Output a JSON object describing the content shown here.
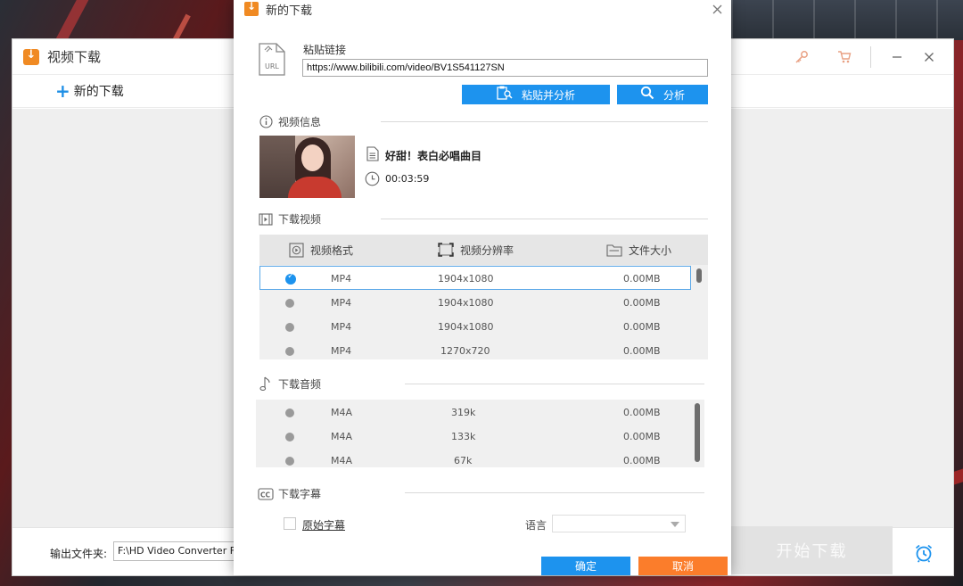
{
  "main": {
    "title": "视频下载",
    "new_download": "新的下载",
    "output_label": "输出文件夹:",
    "output_path": "F:\\HD Video Converter Factory",
    "start_button": "开始下载"
  },
  "dialog": {
    "title": "新的下载",
    "paste_label": "粘贴链接",
    "url_value": "https://www.bilibili.com/video/BV1S541127SN",
    "paste_analyze_button": "粘贴并分析",
    "analyze_button": "分析",
    "sections": {
      "video_info": "视频信息",
      "download_video": "下载视频",
      "download_audio": "下载音频",
      "download_subtitle": "下载字幕"
    },
    "video": {
      "title": "好甜！表白必唱曲目",
      "duration": "00:03:59"
    },
    "video_table": {
      "headers": [
        "视频格式",
        "视频分辨率",
        "文件大小"
      ],
      "rows": [
        {
          "format": "MP4",
          "resolution": "1904x1080",
          "size": "0.00MB",
          "selected": true
        },
        {
          "format": "MP4",
          "resolution": "1904x1080",
          "size": "0.00MB",
          "selected": false
        },
        {
          "format": "MP4",
          "resolution": "1904x1080",
          "size": "0.00MB",
          "selected": false
        },
        {
          "format": "MP4",
          "resolution": "1270x720",
          "size": "0.00MB",
          "selected": false
        }
      ]
    },
    "audio_table": {
      "rows": [
        {
          "format": "M4A",
          "bitrate": "319k",
          "size": "0.00MB"
        },
        {
          "format": "M4A",
          "bitrate": "133k",
          "size": "0.00MB"
        },
        {
          "format": "M4A",
          "bitrate": "67k",
          "size": "0.00MB"
        }
      ]
    },
    "subtitle": {
      "original_label": "原始字幕",
      "language_label": "语言",
      "language_value": ""
    },
    "ok_button": "确定",
    "cancel_button": "取消"
  },
  "colors": {
    "accent_blue": "#1d93ee",
    "cancel_orange": "#fb7d2b",
    "logo_orange": "#f08a23"
  },
  "icons": [
    "download-logo-icon",
    "key-icon",
    "cart-icon",
    "minimize-icon",
    "close-icon",
    "plus-icon",
    "url-file-icon",
    "clipboard-search-icon",
    "search-icon",
    "info-icon",
    "document-icon",
    "clock-icon",
    "film-icon",
    "video-format-icon",
    "resolution-icon",
    "folder-icon",
    "music-note-icon",
    "cc-icon",
    "alarm-clock-icon"
  ]
}
